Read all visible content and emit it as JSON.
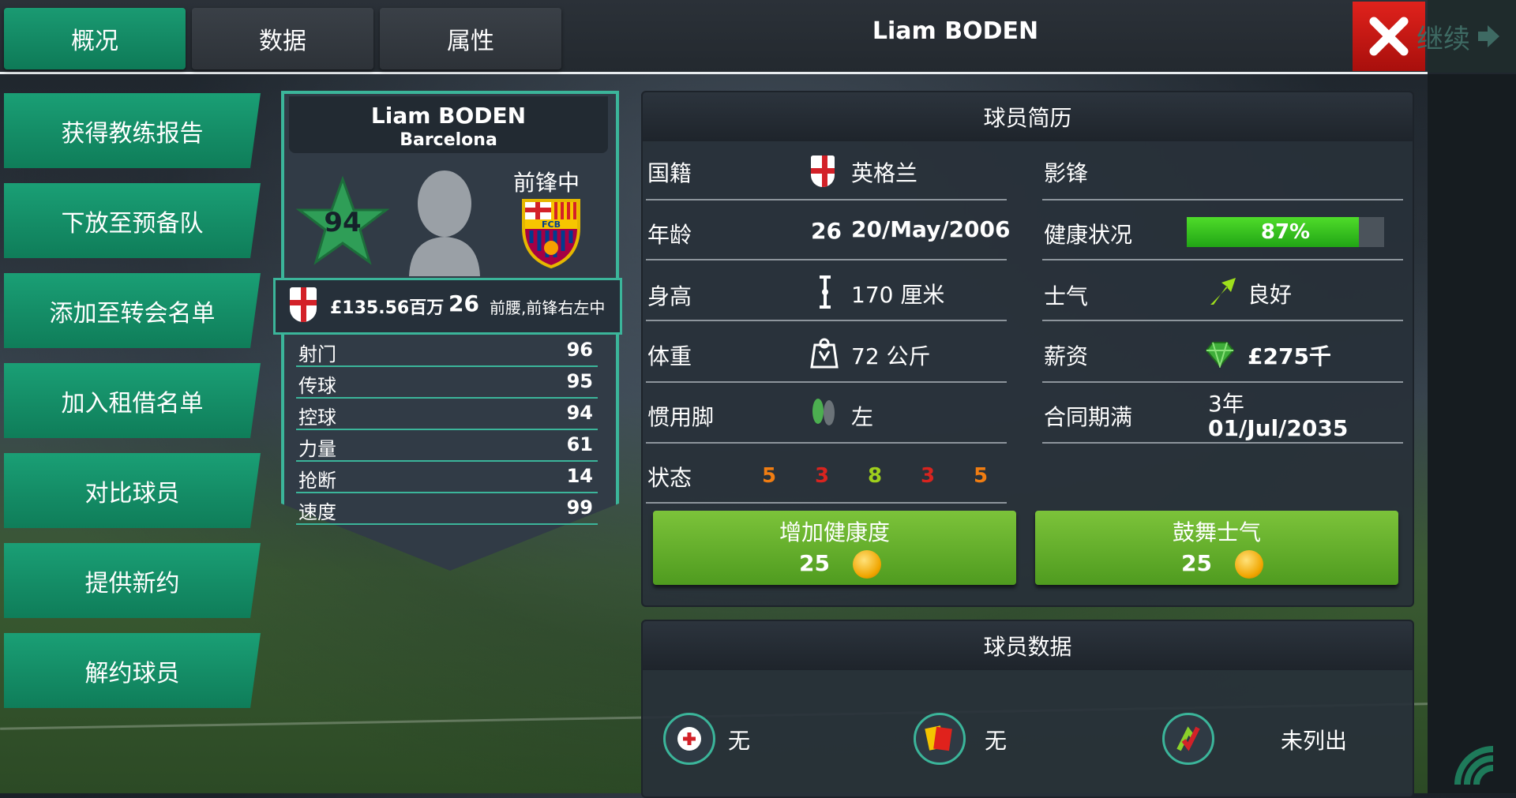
{
  "tabs": [
    {
      "label": "概况",
      "active": true
    },
    {
      "label": "数据",
      "active": false
    },
    {
      "label": "属性",
      "active": false
    }
  ],
  "header": {
    "title": "Liam BODEN",
    "continue_label": "继续"
  },
  "menu": [
    "获得教练报告",
    "下放至预备队",
    "添加至转会名单",
    "加入租借名单",
    "对比球员",
    "提供新约",
    "解约球员"
  ],
  "card": {
    "name": "Liam BODEN",
    "club": "Barcelona",
    "position": "前锋中",
    "rating": "94",
    "club_badge_text": "FCB",
    "value": "£135.56百万",
    "age": "26",
    "positions": "前腰,前锋右左中",
    "attributes": [
      {
        "name": "射门",
        "value": "96"
      },
      {
        "name": "传球",
        "value": "95"
      },
      {
        "name": "控球",
        "value": "94"
      },
      {
        "name": "力量",
        "value": "61"
      },
      {
        "name": "抢断",
        "value": "14"
      },
      {
        "name": "速度",
        "value": "99"
      }
    ]
  },
  "profile": {
    "title": "球员简历",
    "nationality_label": "国籍",
    "nationality": "英格兰",
    "age_label": "年龄",
    "age": "26",
    "dob": "20/May/2006",
    "height_label": "身高",
    "height": "170 厘米",
    "weight_label": "体重",
    "weight": "72 公斤",
    "foot_label": "惯用脚",
    "foot": "左",
    "form_label": "状态",
    "form": [
      "5",
      "3",
      "8",
      "3",
      "5"
    ],
    "role": "影锋",
    "fitness_label": "健康状况",
    "fitness_percent": 87,
    "fitness_text": "87%",
    "morale_label": "士气",
    "morale": "良好",
    "wage_label": "薪资",
    "wage": "£275千",
    "contract_label": "合同期满",
    "contract_years": "3年",
    "contract_end": "01/Jul/2035",
    "boost_fitness": {
      "label": "增加健康度",
      "cost": "25"
    },
    "boost_morale": {
      "label": "鼓舞士气",
      "cost": "25"
    }
  },
  "stats_panel": {
    "title": "球员数据",
    "injury": "无",
    "cards": "无",
    "transfer": "未列出"
  },
  "colors": {
    "accent_green": "#13906a",
    "close_red": "#d3201a",
    "form_orange": "#f07d12",
    "form_red": "#d8241f",
    "form_green": "#9fcf1c",
    "fitness_green": "#3ccb22"
  }
}
